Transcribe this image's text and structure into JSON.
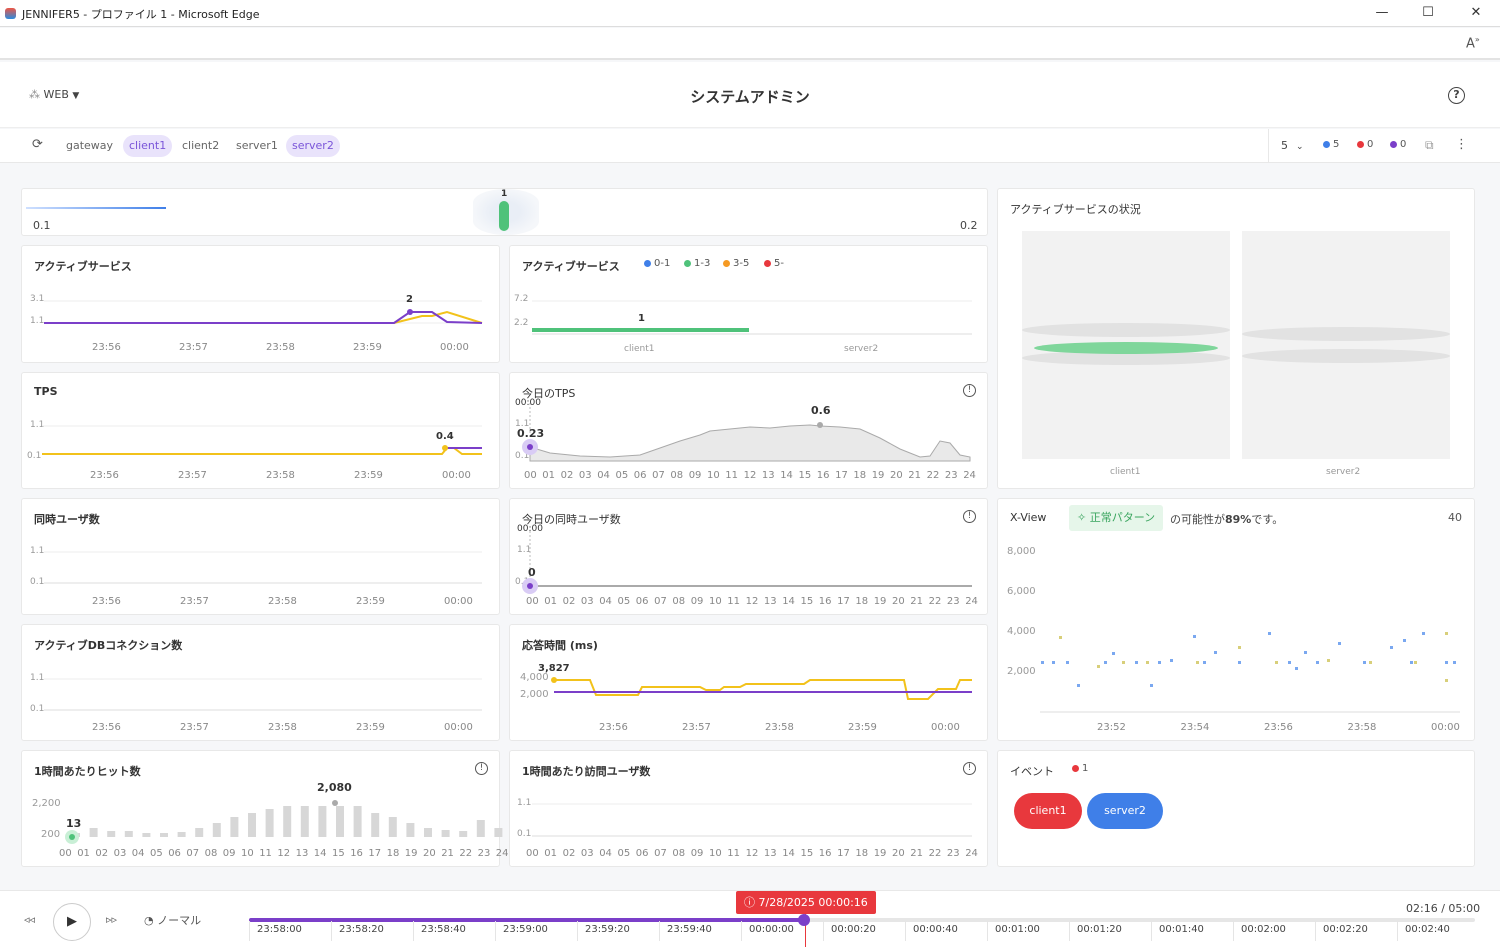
{
  "window": {
    "title": "JENNIFER5 - プロファイル 1 - Microsoft Edge"
  },
  "header": {
    "domain": "WEB",
    "title": "システムアドミン"
  },
  "filters": [
    {
      "label": "gateway",
      "selected": false
    },
    {
      "label": "client1",
      "selected": true
    },
    {
      "label": "client2",
      "selected": false
    },
    {
      "label": "server1",
      "selected": false
    },
    {
      "label": "server2",
      "selected": true
    }
  ],
  "status": {
    "interval": "5",
    "blue": "5",
    "red": "0",
    "purple": "0"
  },
  "colors": {
    "purple": "#7b3fc9",
    "yellow": "#f2c21b",
    "green": "#4fc27a",
    "blue": "#3f7fe8",
    "red": "#e8383d",
    "orange": "#f59a23",
    "accent": "#7a55d9"
  },
  "top_strip": {
    "left": "0.1",
    "right": "0.2",
    "gauge": "1"
  },
  "time_ticks": [
    "23:56",
    "23:57",
    "23:58",
    "23:59",
    "00:00"
  ],
  "hour_ticks": [
    "00",
    "01",
    "02",
    "03",
    "04",
    "05",
    "06",
    "07",
    "08",
    "09",
    "10",
    "11",
    "12",
    "13",
    "14",
    "15",
    "16",
    "17",
    "18",
    "19",
    "20",
    "21",
    "22",
    "23",
    "24"
  ],
  "active_service": {
    "title": "アクティブサービス",
    "y_top": "3.1",
    "y_bottom": "1.1",
    "peak": "2"
  },
  "active_service_bar": {
    "title": "アクティブサービス",
    "legend": [
      "0-1",
      "1-3",
      "3-5",
      "5-"
    ],
    "y_top": "7.2",
    "y_bottom": "2.2",
    "value": "1",
    "categories": [
      "client1",
      "server2"
    ]
  },
  "tps": {
    "title": "TPS",
    "y_top": "1.1",
    "y_bottom": "0.1",
    "peak": "0.4"
  },
  "today_tps": {
    "title": "今日のTPS",
    "time": "00:00",
    "y_top": "1.1",
    "y_bottom": "0.1",
    "current": "0.23",
    "peak": "0.6"
  },
  "concurrent_users": {
    "title": "同時ユーザ数",
    "y_top": "1.1",
    "y_bottom": "0.1"
  },
  "today_concurrent": {
    "title": "今日の同時ユーザ数",
    "time": "00:00",
    "y_top": "1.1",
    "y_bottom": "0.1",
    "current": "0"
  },
  "db_conn": {
    "title": "アクティブDBコネクション数",
    "y_top": "1.1",
    "y_bottom": "0.1"
  },
  "response_time": {
    "title": "応答時間 (ms)",
    "y_top": "4,000",
    "y_bottom": "2,000",
    "current": "3,827"
  },
  "hourly_hits": {
    "title": "1時間あたりヒット数",
    "y_top": "2,200",
    "y_bottom": "200",
    "current": "13",
    "peak": "2,080"
  },
  "hourly_visitors": {
    "title": "1時間あたり訪問ユーザ数",
    "y_top": "1.1",
    "y_bottom": "0.1"
  },
  "active_status": {
    "title": "アクティブサービスの状況",
    "servers": [
      "client1",
      "server2"
    ]
  },
  "xview": {
    "title": "X-View",
    "badge": "正常パターン",
    "prefix": "の可能性が",
    "percent": "89%",
    "suffix": "です。",
    "count": "40",
    "y_ticks": [
      "8,000",
      "6,000",
      "4,000",
      "2,000"
    ],
    "x_ticks": [
      "23:52",
      "23:54",
      "23:56",
      "23:58",
      "00:00"
    ]
  },
  "events": {
    "title": "イベント",
    "count": "1",
    "tags": [
      "client1",
      "server2"
    ]
  },
  "timeline": {
    "marker": "7/28/2025 00:00:16",
    "speed": "ノーマル",
    "elapsed": "02:16 / 05:00",
    "progress": 0.453,
    "ticks": [
      "23:58:00",
      "23:58:20",
      "23:58:40",
      "23:59:00",
      "23:59:20",
      "23:59:40",
      "00:00:00",
      "00:00:20",
      "00:00:40",
      "00:01:00",
      "00:01:20",
      "00:01:40",
      "00:02:00",
      "00:02:20",
      "00:02:40"
    ]
  }
}
